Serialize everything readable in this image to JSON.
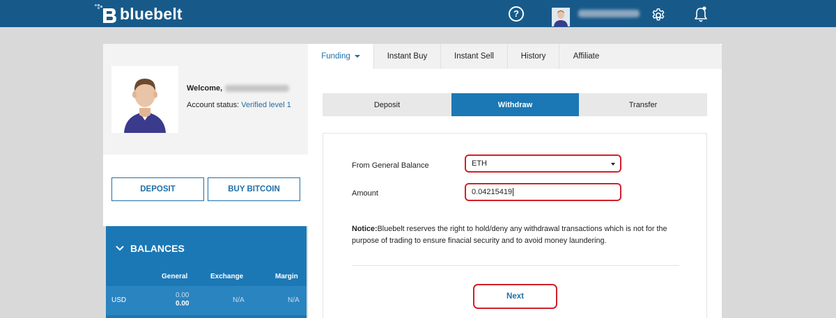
{
  "header": {
    "logo_text": "bluebelt",
    "help_glyph": "?",
    "icons": [
      "help-icon",
      "gear-icon",
      "bell-icon"
    ]
  },
  "profile": {
    "welcome_label": "Welcome,",
    "account_status_label": "Account status:",
    "account_status_value": "Verified level 1"
  },
  "left_actions": {
    "deposit_label": "DEPOSIT",
    "buy_bitcoin_label": "BUY BITCOIN"
  },
  "balances": {
    "title": "BALANCES",
    "columns": [
      "General",
      "Exchange",
      "Margin"
    ],
    "rows": [
      {
        "currency": "USD",
        "general_top": "0.00",
        "general_bottom": "0.00",
        "exchange": "N/A",
        "margin": "N/A"
      }
    ]
  },
  "tabs": {
    "items": [
      {
        "label": "Funding",
        "active": true
      },
      {
        "label": "Instant Buy"
      },
      {
        "label": "Instant Sell"
      },
      {
        "label": "History"
      },
      {
        "label": "Affiliate"
      }
    ]
  },
  "subtabs": {
    "deposit": "Deposit",
    "withdraw": "Withdraw",
    "transfer": "Transfer"
  },
  "form": {
    "from_label": "From General Balance",
    "from_value": "ETH",
    "amount_label": "Amount",
    "amount_value": "0.04215419",
    "notice_bold": "Notice:",
    "notice_text": "Bluebelt reserves the right to hold/deny any withdrawal transactions which is not for the purpose of trading to ensure finacial security and to avoid money laundering.",
    "next_label": "Next"
  },
  "colors": {
    "brand": "#175a8a",
    "accent": "#1b78b5",
    "highlight": "#d21f2b"
  }
}
